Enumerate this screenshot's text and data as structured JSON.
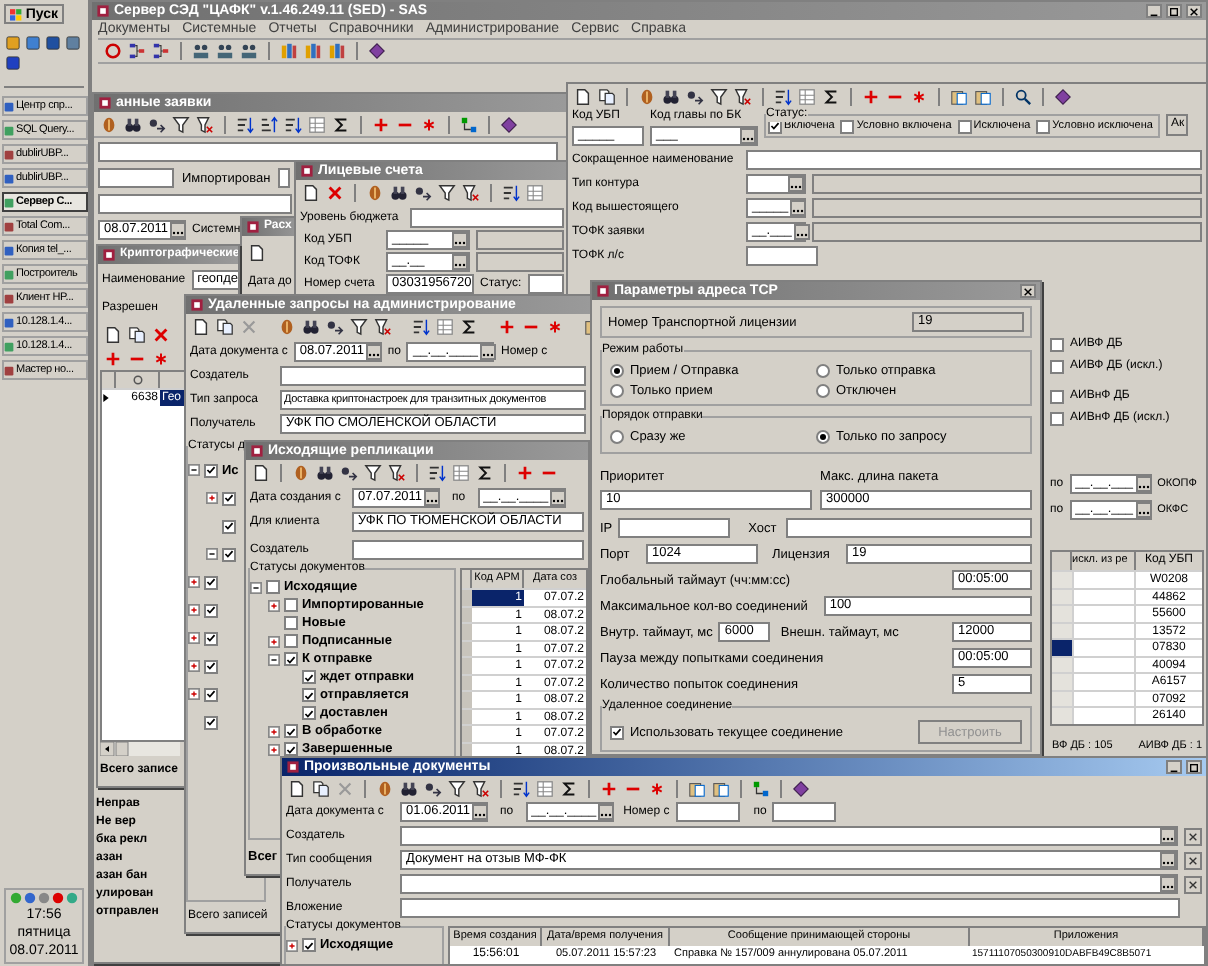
{
  "taskbar": {
    "start": "Пуск",
    "tasks": [
      {
        "label": "Центр спр...",
        "selected": false
      },
      {
        "label": "SQL Query...",
        "selected": false
      },
      {
        "label": "dublirUBP...",
        "selected": false
      },
      {
        "label": "dublirUBP...",
        "selected": false
      },
      {
        "label": "Сервер С...",
        "selected": true
      },
      {
        "label": "Total Com...",
        "selected": false
      },
      {
        "label": "Копия tel_...",
        "selected": false
      },
      {
        "label": "Построитель",
        "selected": false
      },
      {
        "label": "Клиент HP...",
        "selected": false
      },
      {
        "label": "10.128.1.4...",
        "selected": false
      },
      {
        "label": "10.128.1.4...",
        "selected": false
      },
      {
        "label": "Мастер но...",
        "selected": false
      }
    ],
    "clock": {
      "time": "17:56",
      "day": "пятница",
      "date": "08.07.2011"
    }
  },
  "main": {
    "title": "Сервер СЭД \"ЦАФК\" v.1.46.249.11 (SED) - SAS",
    "active": false,
    "menu": [
      "Документы",
      "Системные",
      "Отчеты",
      "Справочники",
      "Администрирование",
      "Сервис",
      "Справка"
    ]
  },
  "ubp_card": {
    "kod_ubp": {
      "label": "Код УБП",
      "value": "_____"
    },
    "glava": {
      "label": "Код главы по БК",
      "value": "___"
    },
    "status_label": "Статус:",
    "statuses": [
      {
        "label": "Включена",
        "checked": true
      },
      {
        "label": "Условно включена",
        "checked": false
      },
      {
        "label": "Исключена",
        "checked": false
      },
      {
        "label": "Условно исключена",
        "checked": false
      }
    ],
    "button": "Ак",
    "rows": [
      {
        "kind": "text",
        "label": "Сокращенное наименование"
      },
      {
        "kind": "lookup",
        "label": "Тип контура"
      },
      {
        "kind": "lookup",
        "label": "Код вышестоящего",
        "value": "_____"
      },
      {
        "kind": "lookup",
        "label": "ТОФК заявки",
        "value": "__.___"
      },
      {
        "kind": "short",
        "label": "ТОФК л/с"
      }
    ],
    "flags": [
      {
        "label": "АИВФ ДБ",
        "checked": false
      },
      {
        "label": "АИВФ ДБ (искл.)",
        "checked": false
      },
      {
        "label": "АИВнФ ДБ",
        "checked": false
      },
      {
        "label": "АИВнФ ДБ (искл.)",
        "checked": false
      }
    ],
    "filters": [
      {
        "label": "по",
        "value": "__.__.___",
        "right_label": "ОКОПФ"
      },
      {
        "label": "по",
        "value": "__.__.___",
        "right_label": "ОКФС"
      }
    ],
    "table": {
      "columns": [
        "искл. из ре",
        "Код УБП"
      ],
      "rows": [
        {
          "code": "W0208",
          "selected": false
        },
        {
          "code": "44862",
          "selected": false
        },
        {
          "code": "55600",
          "selected": false
        },
        {
          "code": "13572",
          "selected": false
        },
        {
          "code": "07830",
          "selected": true
        },
        {
          "code": "40094",
          "selected": false
        },
        {
          "code": "A6157",
          "selected": false
        },
        {
          "code": "07092",
          "selected": false
        },
        {
          "code": "26140",
          "selected": false
        }
      ]
    },
    "status_bar": [
      "ВФ ДБ : 105",
      "АИВФ ДБ : 1"
    ]
  },
  "requests_window": {
    "title": "анные заявки",
    "active": false,
    "imported_label": "Импортирован",
    "date": "08.07.2011",
    "system_label": "Системн",
    "fragments": [
      "Неправ",
      "Не вер",
      "бка рекл",
      "азан",
      "азан бан",
      "улирован",
      "отправлен"
    ]
  },
  "accounts_window": {
    "title": "Лицевые счета",
    "active": false,
    "level_label": "Уровень бюджета",
    "ubp": {
      "label": "Код УБП",
      "value": "_____"
    },
    "tofk": {
      "label": "Код ТОФК",
      "value": "__.__"
    },
    "account": {
      "label": "Номер счета",
      "value": "03031956720"
    },
    "status_label": "Статус:"
  },
  "expense_window": {
    "title": "Расх",
    "active": false,
    "date_label": "Дата до"
  },
  "crypto_window": {
    "title": "Криптографические",
    "active": false,
    "name_label": "Наименование",
    "name_value": "геопде",
    "allowed_label": "Разрешен",
    "rows": [
      {
        "id": "6638",
        "name": "Гео",
        "selected": true
      }
    ],
    "footer": "Всего записе"
  },
  "remote_window": {
    "title": "Удаленные запросы на администрирование",
    "active": false,
    "date_label": "Дата документа с",
    "date_from": "08.07.2011",
    "to_label": "по",
    "date_to": "__.__.____",
    "number_label": "Номер с",
    "creator_label": "Создатель",
    "type_label": "Тип запроса",
    "type_value": "Доставка криптонастроек для транзитных документов",
    "recipient_label": "Получатель",
    "recipient_value": "УФК ПО СМОЛЕНСКОЙ ОБЛАСТИ",
    "statuses_label": "Статусы д",
    "tree": [
      {
        "label": "Ис",
        "checked": true,
        "expanded": true,
        "children": [
          {
            "checked": true,
            "expanded": false
          },
          {
            "checked": true
          },
          {
            "checked": true,
            "expanded": true
          }
        ]
      },
      {
        "checked": true,
        "expanded": false
      },
      {
        "checked": true,
        "expanded": false
      },
      {
        "checked": true,
        "expanded": false
      },
      {
        "checked": true,
        "expanded": false
      },
      {
        "checked": true,
        "expanded": false
      },
      {
        "checked": true
      }
    ],
    "footer": "Всего записей"
  },
  "replication_window": {
    "title": "Исходящие репликации",
    "active": false,
    "date_label": "Дата создания с",
    "date_from": "07.07.2011",
    "to_label": "по",
    "date_to": "__.__.____",
    "client_label": "Для клиента",
    "client_value": "УФК ПО ТЮМЕНСКОЙ ОБЛАСТИ",
    "creator_label": "Создатель",
    "statuses_label": "Статусы документов",
    "tree": [
      {
        "label": "Исходящие",
        "checked": false,
        "expanded": true,
        "children": [
          {
            "label": "Импортированные",
            "checked": false,
            "expanded": false
          },
          {
            "label": "Новые",
            "checked": false
          },
          {
            "label": "Подписанные",
            "checked": false,
            "expanded": false
          },
          {
            "label": "К отправке",
            "checked": true,
            "expanded": true,
            "children": [
              {
                "label": "ждет отправки",
                "checked": true
              },
              {
                "label": "отправляется",
                "checked": true
              },
              {
                "label": "доставлен",
                "checked": true
              }
            ]
          },
          {
            "label": "В обработке",
            "checked": true,
            "expanded": false
          },
          {
            "label": "Завершенные",
            "checked": true,
            "expanded": false
          }
        ]
      }
    ],
    "columns": [
      "Код АРМ",
      "Дата соз"
    ],
    "rows": [
      {
        "arm": "1",
        "date": "07.07.2",
        "selected": true
      },
      {
        "arm": "1",
        "date": "08.07.2",
        "selected": false
      },
      {
        "arm": "1",
        "date": "08.07.2",
        "selected": false
      },
      {
        "arm": "1",
        "date": "07.07.2",
        "selected": false
      },
      {
        "arm": "1",
        "date": "07.07.2",
        "selected": false
      },
      {
        "arm": "1",
        "date": "07.07.2",
        "selected": false
      },
      {
        "arm": "1",
        "date": "08.07.2",
        "selected": false
      },
      {
        "arm": "1",
        "date": "08.07.2",
        "selected": false
      },
      {
        "arm": "1",
        "date": "07.07.2",
        "selected": false
      },
      {
        "arm": "1",
        "date": "08.07.2",
        "selected": false
      }
    ],
    "footer": "Всег"
  },
  "tcp_dialog": {
    "title": "Параметры адреса TCP",
    "license_label": "Номер Транспортной лицензии",
    "license_value": "19",
    "mode_group": "Режим работы",
    "modes": [
      {
        "label": "Прием / Отправка",
        "selected": true
      },
      {
        "label": "Только отправка",
        "selected": false
      },
      {
        "label": "Только прием",
        "selected": false
      },
      {
        "label": "Отключен",
        "selected": false
      }
    ],
    "order_group": "Порядок отправки",
    "orders": [
      {
        "label": "Сразу же",
        "selected": false
      },
      {
        "label": "Только по запросу",
        "selected": true
      }
    ],
    "priority_label": "Приоритет",
    "priority": "10",
    "packet_label": "Макс. длина пакета",
    "packet": "300000",
    "ip_label": "IP",
    "host_label": "Хост",
    "port_label": "Порт",
    "port": "1024",
    "lic_label": "Лицензия",
    "lic": "19",
    "global_timeout_label": "Глобальный таймаут (чч:мм:сс)",
    "global_timeout": "00:05:00",
    "max_conn_label": "Максимальное кол-во соединений",
    "max_conn": "100",
    "inner_label": "Внутр. таймаут, мс",
    "inner": "6000",
    "outer_label": "Внешн. таймаут, мс",
    "outer": "12000",
    "pause_label": "Пауза между попытками соединения",
    "pause": "00:05:00",
    "attempts_label": "Количество попыток соединения",
    "attempts": "5",
    "remote_group": "Удаленное соединение",
    "use_current": {
      "label": "Использовать текущее соединение",
      "checked": true
    },
    "setup_button": {
      "label": "Настроить",
      "disabled": true
    }
  },
  "docs_window": {
    "title": "Произвольные документы",
    "active": true,
    "date_label": "Дата документа с",
    "date_from": "01.06.2011",
    "to_label": "по",
    "date_to": "__.__.____",
    "number_label": "Номер с",
    "number_to_label": "по",
    "fields": [
      {
        "label": "Создатель",
        "clearable": true
      },
      {
        "label": "Тип сообщения",
        "value": "Документ на отзыв МФ-ФК",
        "clearable": true
      },
      {
        "label": "Получатель",
        "clearable": true
      },
      {
        "label": "Вложение",
        "clearable": false
      }
    ],
    "statuses_label": "Статусы документов",
    "tree": [
      {
        "label": "Исходящие",
        "checked": true,
        "expanded": false
      }
    ],
    "columns": [
      "Время создания",
      "Дата/время получения",
      "Сообщение принимающей стороны",
      "Приложения"
    ],
    "rows": [
      {
        "created": "15:56:01",
        "received": "05.07.2011 15:57:23",
        "message": "Справка № 157/009 аннулирована 05.07.2011",
        "attachments": "15711107050300910DABFB49C8B5071"
      }
    ]
  }
}
